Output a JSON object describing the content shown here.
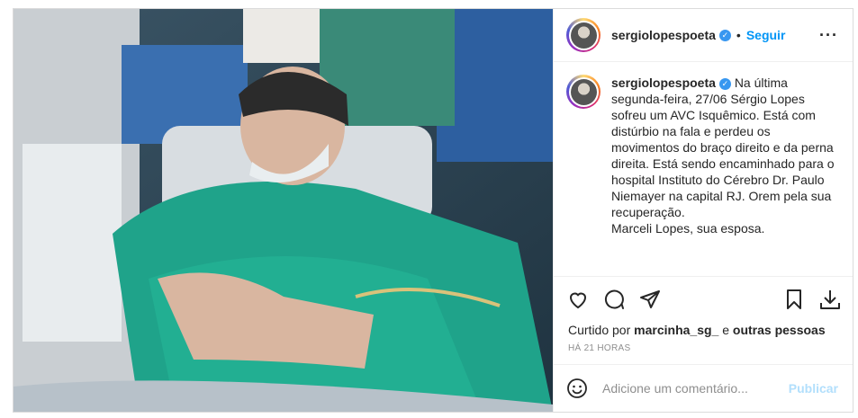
{
  "post": {
    "username": "sergiolopespoeta",
    "follow_label": "Seguir",
    "caption_text": "Na última segunda-feira, 27/06 Sérgio Lopes sofreu um AVC Isquêmico. Está com distúrbio na fala e perdeu os movimentos do braço direito e da perna direita. Está sendo encaminhado para o hospital Instituto do Cérebro Dr. Paulo Niemayer na capital RJ. Orem pela sua recuperação.",
    "caption_signature": "Marceli Lopes, sua esposa.",
    "likes_prefix": "Curtido por",
    "liked_by_user": "marcinha_sg_",
    "likes_and": "e",
    "likes_others": "outras pessoas",
    "timestamp": "HÁ 21 HORAS",
    "comment_placeholder": "Adicione um comentário...",
    "publish_label": "Publicar"
  },
  "icons": {
    "more": "more-options-icon",
    "like": "heart-icon",
    "comment": "comment-icon",
    "share": "share-icon",
    "save": "bookmark-icon",
    "download": "download-icon",
    "emoji": "emoji-icon",
    "verified": "verified-badge-icon"
  },
  "colors": {
    "accent": "#0095f6",
    "verified": "#3897f0",
    "publish_disabled": "#b2dffc",
    "muted": "#8e8e8e"
  }
}
